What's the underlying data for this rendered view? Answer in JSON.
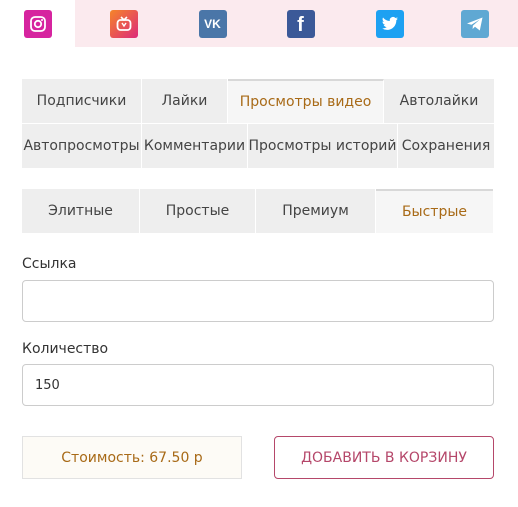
{
  "social": {
    "items": [
      {
        "name": "instagram",
        "active": true,
        "color": "#d6249f"
      },
      {
        "name": "igtv",
        "active": false,
        "color": "#f58529"
      },
      {
        "name": "vk",
        "active": false,
        "color": "#4a76a8",
        "glyph": "VK"
      },
      {
        "name": "facebook",
        "active": false,
        "color": "#3b5998",
        "glyph": "f"
      },
      {
        "name": "twitter",
        "active": false,
        "color": "#1da1f2"
      },
      {
        "name": "telegram",
        "active": false,
        "color": "#5fa8d3"
      }
    ]
  },
  "services": {
    "row1": [
      "Подписчики",
      "Лайки",
      "Просмотры видео",
      "Автолайки"
    ],
    "row2": [
      "Автопросмотры",
      "Комментарии",
      "Просмотры историй",
      "Сохранения"
    ],
    "active": "Просмотры видео"
  },
  "quality": {
    "tabs": [
      "Элитные",
      "Простые",
      "Премиум",
      "Быстрые"
    ],
    "active": "Быстрые"
  },
  "form": {
    "link_label": "Ссылка",
    "link_value": "",
    "quantity_label": "Количество",
    "quantity_value": "150"
  },
  "price": {
    "text": "Стоимость: 67.50 р"
  },
  "cart": {
    "label": "ДОБАВИТЬ В КОРЗИНУ"
  },
  "colors": {
    "accent": "#a86a17",
    "brand": "#b5476a"
  }
}
